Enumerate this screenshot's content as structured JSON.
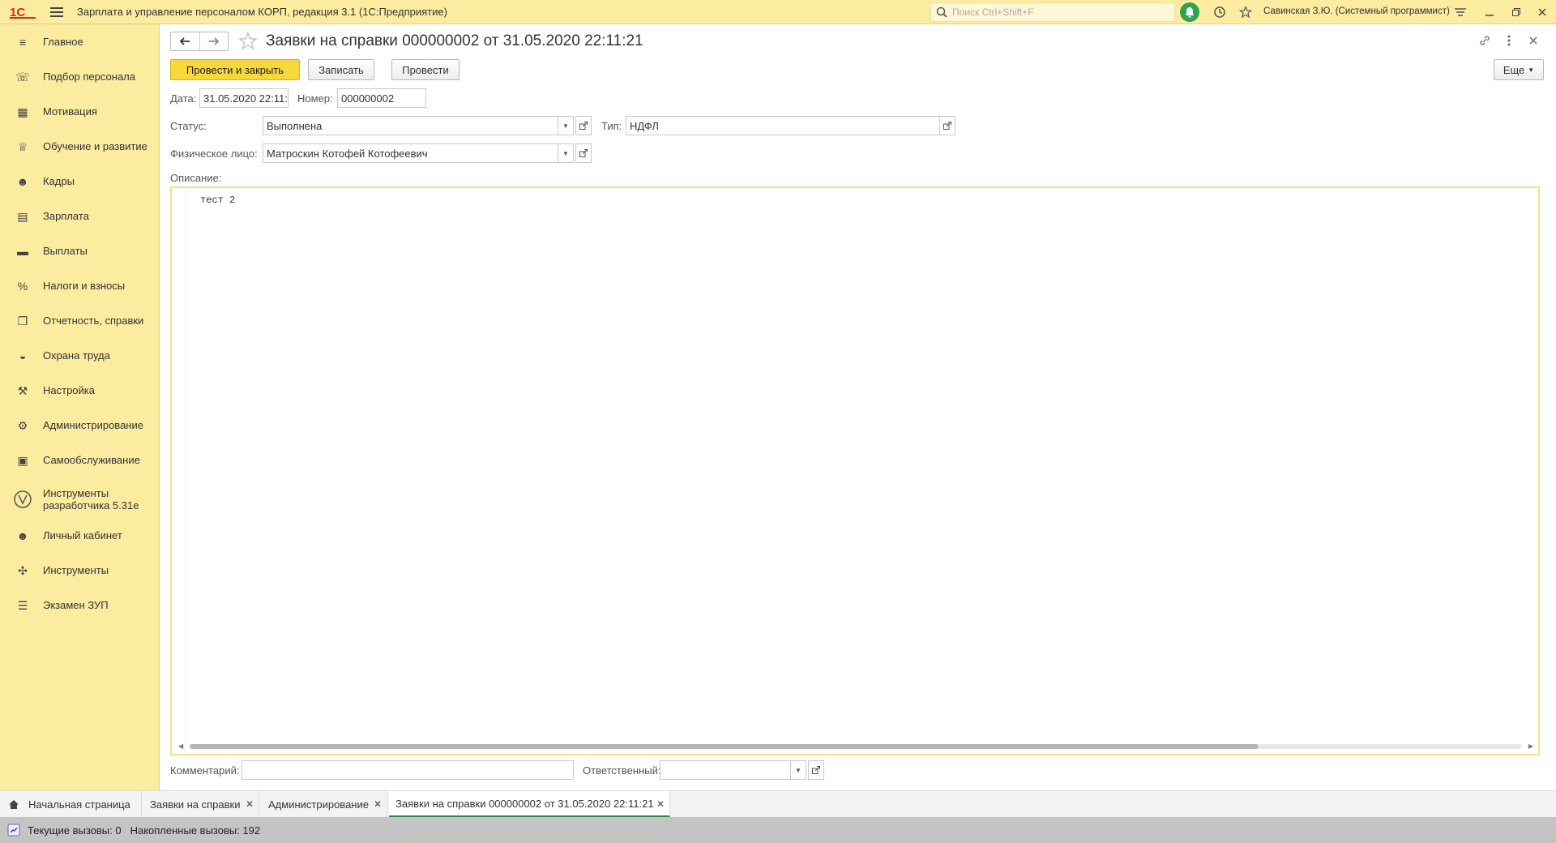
{
  "app": {
    "title": "Зарплата и управление персоналом КОРП, редакция 3.1  (1С:Предприятие)",
    "logo": "1С",
    "search_placeholder": "Поиск Ctrl+Shift+F",
    "user": "Савинская З.Ю. (Системный программист)"
  },
  "sidebar": {
    "items": [
      {
        "label": "Главное",
        "icon": "menu-icon"
      },
      {
        "label": "Подбор персонала",
        "icon": "recruit-icon"
      },
      {
        "label": "Мотивация",
        "icon": "gift-icon"
      },
      {
        "label": "Обучение и развитие",
        "icon": "graduation-icon"
      },
      {
        "label": "Кадры",
        "icon": "people-icon"
      },
      {
        "label": "Зарплата",
        "icon": "calculator-icon"
      },
      {
        "label": "Выплаты",
        "icon": "wallet-icon"
      },
      {
        "label": "Налоги и взносы",
        "icon": "percent-icon"
      },
      {
        "label": "Отчетность, справки",
        "icon": "reports-icon"
      },
      {
        "label": "Охрана труда",
        "icon": "helmet-icon"
      },
      {
        "label": "Настройка",
        "icon": "wrench-icon"
      },
      {
        "label": "Администрирование",
        "icon": "gear-icon"
      },
      {
        "label": "Самообслуживание",
        "icon": "id-card-icon"
      },
      {
        "label": "Инструменты разработчика 5.31е",
        "icon": "dev-tools-icon"
      },
      {
        "label": "Личный кабинет",
        "icon": "user-icon"
      },
      {
        "label": "Инструменты",
        "icon": "tools-icon"
      },
      {
        "label": "Экзамен ЗУП",
        "icon": "list-icon"
      }
    ]
  },
  "document": {
    "title": "Заявки на справки 000000002 от 31.05.2020 22:11:21",
    "buttons": {
      "post_close": "Провести и закрыть",
      "save": "Записать",
      "post": "Провести",
      "more": "Еще"
    },
    "fields": {
      "date_label": "Дата:",
      "date_value": "31.05.2020 22:11:",
      "number_label": "Номер:",
      "number_value": "000000002",
      "status_label": "Статус:",
      "status_value": "Выполнена",
      "type_label": "Тип:",
      "type_value": "НДФЛ",
      "person_label": "Физическое лицо:",
      "person_value": "Матроскин Котофей Котофеевич",
      "description_label": "Описание:",
      "description_value": "тест 2",
      "comment_label": "Комментарий:",
      "comment_value": "",
      "responsible_label": "Ответственный:",
      "responsible_value": ""
    }
  },
  "tabs": [
    {
      "label": "Начальная страница",
      "closable": false
    },
    {
      "label": "Заявки на справки",
      "closable": true
    },
    {
      "label": "Администрирование",
      "closable": true
    },
    {
      "label": "Заявки на справки 000000002 от 31.05.2020 22:11:21",
      "closable": true,
      "active": true
    }
  ],
  "status": {
    "current_calls": "Текущие вызовы: 0",
    "accumulated_calls": "Накопленные вызовы: 192"
  },
  "colors": {
    "panel_bg": "#fbeca0",
    "primary_button": "#f7d83b",
    "accent_green": "#2ea44f"
  }
}
